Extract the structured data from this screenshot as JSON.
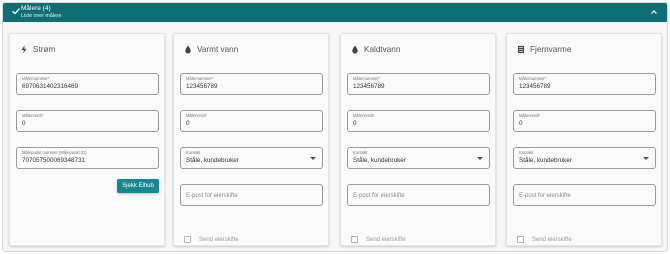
{
  "header": {
    "title": "Målere (4)",
    "subtitle": "Liste over målere",
    "accent_color": "#0e6e74",
    "left_icon": "check-icon",
    "right_icon": "chevron-up-icon"
  },
  "cards": [
    {
      "title": "Strøm",
      "icon": "lightning-icon",
      "meter_number_label": "Målernummer*",
      "meter_number_value": "6970631402316469",
      "meter_value_label": "Målerverdi*",
      "meter_value_value": "0",
      "metering_point_label": "Målepunkt nummer (Målepunkt ID)",
      "metering_point_value": "707057500069348731",
      "button_label": "Sjekk Elhub"
    },
    {
      "title": "Varmt vann",
      "icon": "water-drop-icon",
      "meter_number_label": "Målernummer*",
      "meter_number_value": "123456789",
      "meter_value_label": "Målerverdi*",
      "meter_value_value": "0",
      "contact_label": "Kontakt",
      "contact_value": "Ståle, kundebruker",
      "email_placeholder": "E-post for eierskifte",
      "checkbox_label": "Send eierskifte"
    },
    {
      "title": "Kaldtvann",
      "icon": "water-drop-icon",
      "meter_number_label": "Målernummer*",
      "meter_number_value": "123456789",
      "meter_value_label": "Målerverdi*",
      "meter_value_value": "0",
      "contact_label": "Kontakt",
      "contact_value": "Ståle, kundebruker",
      "email_placeholder": "E-post for eierskifte",
      "checkbox_label": "Send eierskifte"
    },
    {
      "title": "Fjernvarme",
      "icon": "radiator-icon",
      "meter_number_label": "Målernummer*",
      "meter_number_value": "123456789",
      "meter_value_label": "Målerverdi*",
      "meter_value_value": "0",
      "contact_label": "Kontakt",
      "contact_value": "Ståle, kundebruker",
      "email_placeholder": "E-post for eierskifte",
      "checkbox_label": "Send eierskifte"
    }
  ],
  "colors": {
    "button": "#158892",
    "panel_background": "#f6f6f6"
  }
}
